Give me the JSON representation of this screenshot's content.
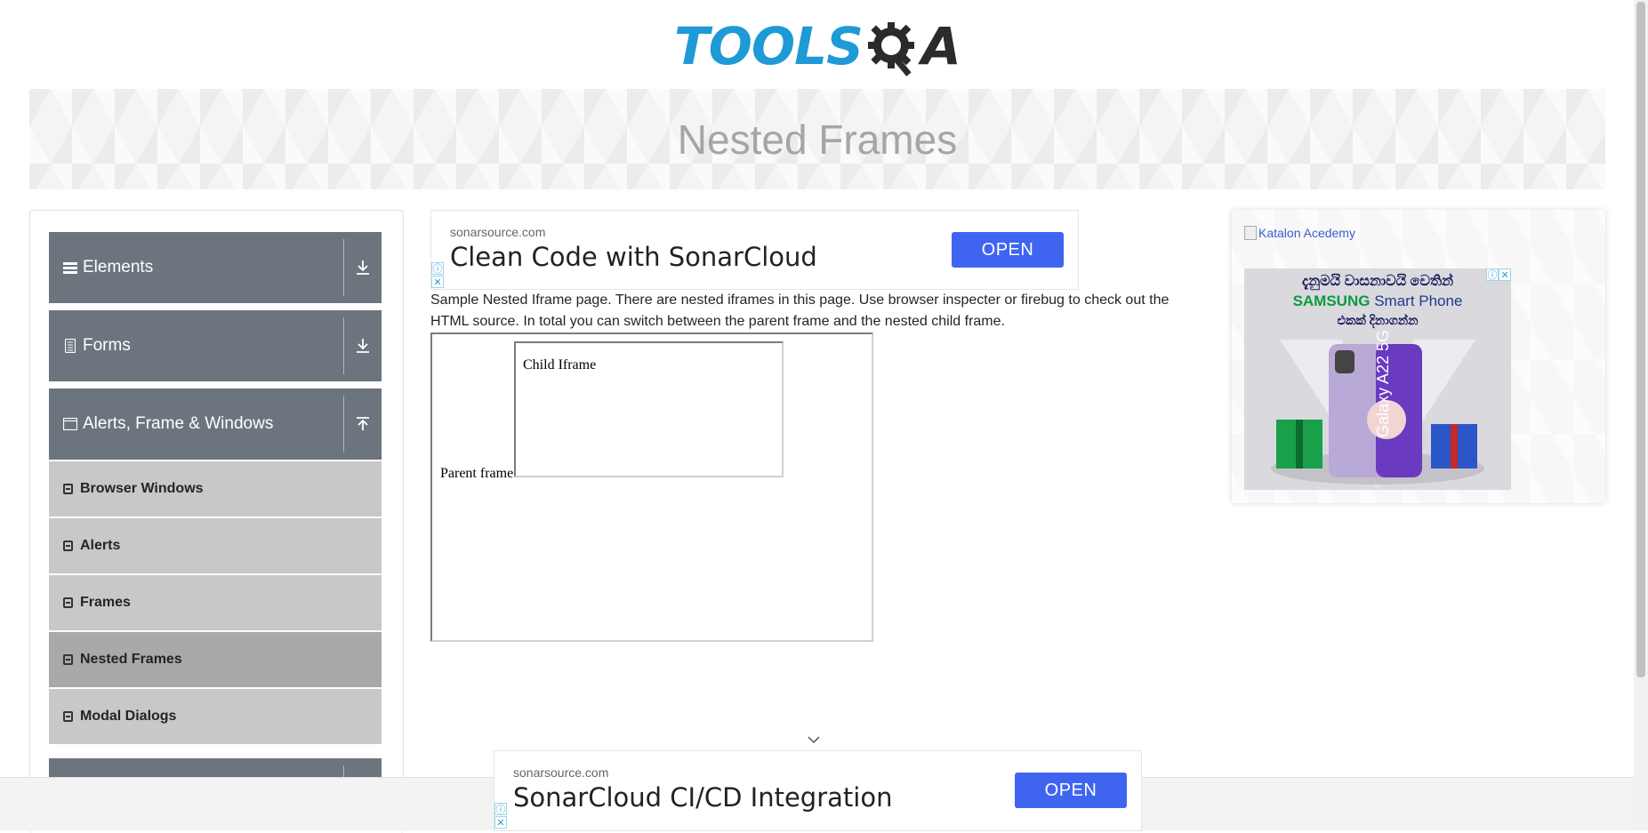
{
  "header": {
    "logo_text_tools": "TOOLS",
    "logo_text_qa": "A"
  },
  "banner": {
    "title": "Nested Frames"
  },
  "sidebar": {
    "groups": [
      {
        "label": "Elements",
        "icon": "list-icon",
        "arrow": "download-arrow-icon"
      },
      {
        "label": "Forms",
        "icon": "document-icon",
        "arrow": "download-arrow-icon"
      },
      {
        "label": "Alerts, Frame & Windows",
        "icon": "window-icon",
        "arrow": "upload-arrow-icon"
      }
    ],
    "items": [
      {
        "label": "Browser Windows"
      },
      {
        "label": "Alerts"
      },
      {
        "label": "Frames"
      },
      {
        "label": "Nested Frames",
        "active": true
      },
      {
        "label": "Modal Dialogs"
      }
    ]
  },
  "ad_top": {
    "domain": "sonarsource.com",
    "title": "Clean Code with SonarCloud",
    "button": "OPEN"
  },
  "description": "Sample Nested Iframe page. There are nested iframes in this page. Use browser inspecter or firebug to check out the HTML source. In total you can switch between the parent frame and the nested child frame.",
  "frames": {
    "parent_label": "Parent frame",
    "child_label": "Child Iframe"
  },
  "right_ad": {
    "img_alt": "Katalon Acedemy",
    "line1": "දැනුමයි වාසනාවයි වෙතින්",
    "line2_brand": "SAMSUNG",
    "line2_rest": "Smart Phone",
    "line3": "එකක් දිනාගන්න",
    "phone_label": "Galaxy A22 5G"
  },
  "ad_bottom": {
    "domain": "sonarsource.com",
    "title": "SonarCloud CI/CD Integration",
    "button": "OPEN"
  },
  "colors": {
    "accent": "#3f65f0",
    "sidebar_group": "#6c757d",
    "sidebar_item": "#c8c8c8",
    "logo_blue": "#1e9ad6"
  }
}
